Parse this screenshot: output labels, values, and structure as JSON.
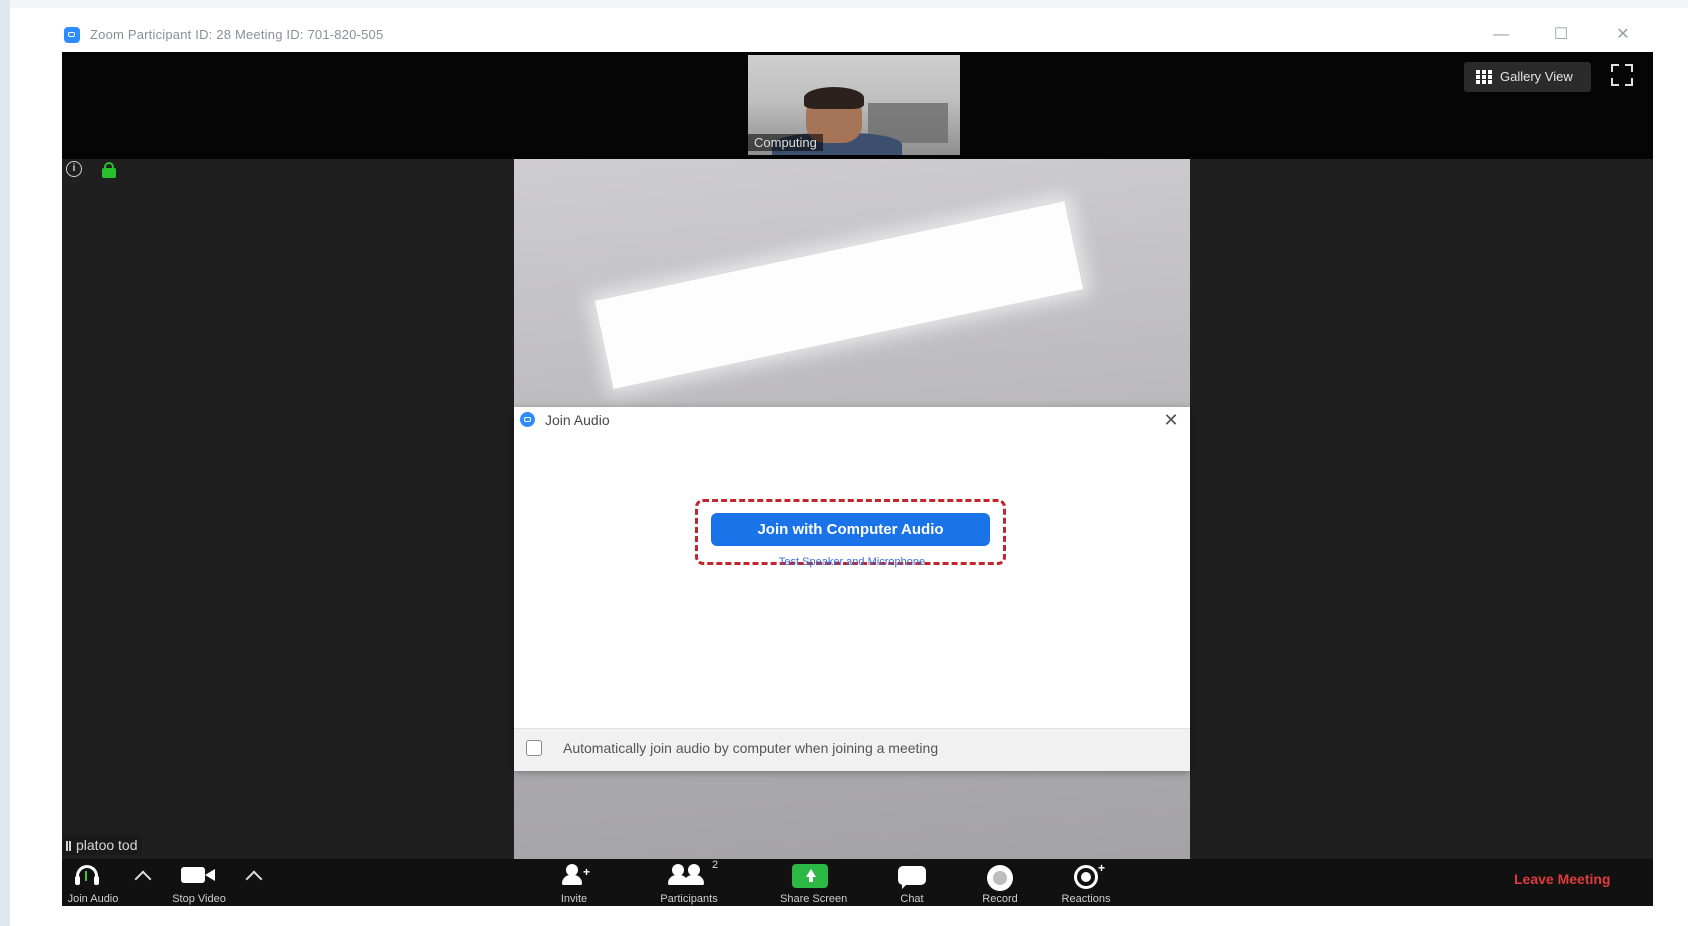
{
  "window": {
    "title": "Zoom Participant ID: 28   Meeting ID: 701-820-505",
    "controls": [
      "—",
      "☐",
      "✕"
    ]
  },
  "header": {
    "gallery_view_label": "Gallery View",
    "thumbnail_name": "Computing"
  },
  "dialog": {
    "title": "Join Audio",
    "close_symbol": "✕",
    "join_button_label": "Join with Computer Audio",
    "test_link_label": "Test Speaker and Microphone",
    "auto_join_label": "Automatically join audio by computer when joining a meeting",
    "auto_join_checked": false,
    "highlight_color": "#c0272d",
    "button_color": "#1a73e8"
  },
  "participant": {
    "name_label": "platoo tod"
  },
  "toolbar": {
    "join_audio": "Join Audio",
    "stop_video": "Stop Video",
    "invite": "Invite",
    "participants": "Participants",
    "participants_count": "2",
    "share_screen": "Share Screen",
    "chat": "Chat",
    "record": "Record",
    "reactions": "Reactions",
    "leave_meeting": "Leave Meeting"
  },
  "colors": {
    "leave_red": "#e03b3b",
    "share_green": "#2cb845",
    "lock_green": "#26c12e",
    "zoom_blue": "#2d8cff"
  }
}
